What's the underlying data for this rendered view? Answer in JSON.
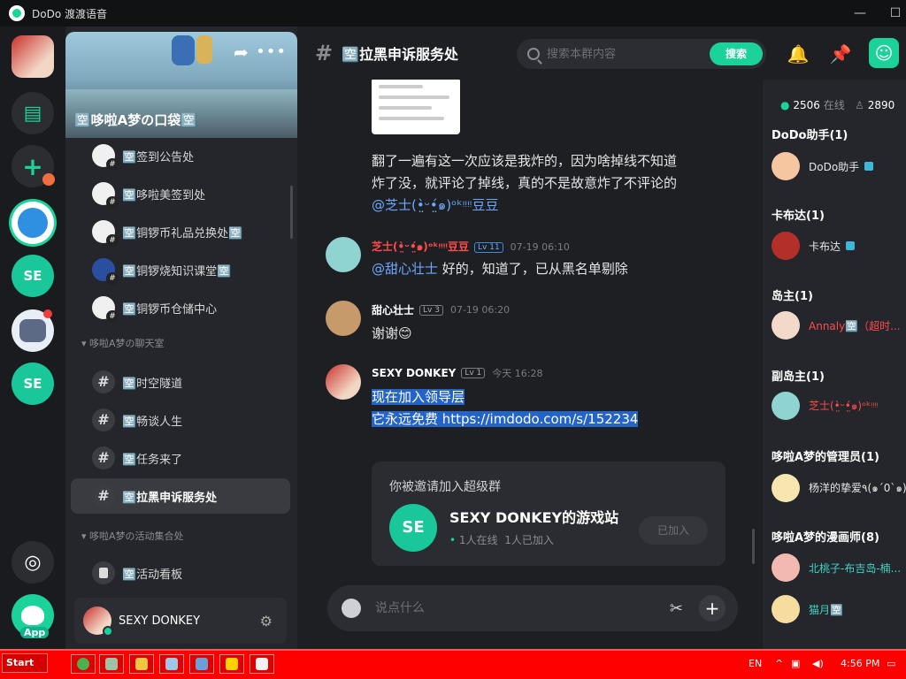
{
  "window": {
    "title": "DoDo 渡渡语音",
    "minimize": "—",
    "maximize": "☐"
  },
  "rail": {
    "servers": [
      "SE",
      "SE"
    ],
    "app_badge": "App"
  },
  "group": {
    "name": "🈳哆啦A梦の口袋🈳",
    "channels": [
      {
        "label": "🈳签到公告处"
      },
      {
        "label": "🈳哆啦美签到处"
      },
      {
        "label": "🈳铜锣币礼品兑换处🈳"
      },
      {
        "label": "🈳铜锣烧知识课堂🈳"
      },
      {
        "label": "🈳铜锣币仓储中心"
      }
    ],
    "category_chat": "哆啦A梦の聊天室",
    "chat_channels": [
      {
        "label": "🈳时空隧道"
      },
      {
        "label": "🈳畅谈人生"
      },
      {
        "label": "🈳任务来了"
      },
      {
        "label": "🈳拉黑申诉服务处"
      }
    ],
    "category_activity": "哆啦A梦の活动集合处",
    "activity_channels": [
      {
        "label": "🈳活动看板"
      }
    ]
  },
  "user": {
    "name": "SEXY DONKEY"
  },
  "header": {
    "hash": "#",
    "title": "🈳拉黑申诉服务处",
    "search_placeholder": "搜索本群内容",
    "search_button": "搜索"
  },
  "messages": {
    "m0_line1": "翻了一遍有这一次应该是我炸的，因为啥掉线不知道",
    "m0_line2": "炸了没，就评论了掉线，真的不是故意炸了不评论的",
    "m0_mention": "@芝士(•̤̀ᵕ•̤́๑)ᵒᵏᵎᵎᵎᵎ豆豆",
    "m1_name": "芝士(•̤̀ᵕ•̤́๑)ᵒᵏᵎᵎᵎᵎ豆豆",
    "m1_level": "Lv 11",
    "m1_time": "07-19 06:10",
    "m1_mention": "@甜心壮士",
    "m1_text": " 好的，知道了，已从黑名单剔除",
    "m2_name": "甜心壮士",
    "m2_level": "Lv 3",
    "m2_time": "07-19 06:20",
    "m2_text": "谢谢😊",
    "m3_name": "SEXY DONKEY",
    "m3_level": "Lv 1",
    "m3_time": "今天 16:28",
    "m3_line1": "现在加入领导层",
    "m3_line2": "它永远免费 https://imdodo.com/s/152234"
  },
  "invite": {
    "title": "你被邀请加入超级群",
    "icon_text": "SE",
    "name": "SEXY DONKEY的游戏站",
    "online": "1人在线",
    "joined": "1人已加入",
    "button": "已加入"
  },
  "composer": {
    "placeholder": "说点什么",
    "plus": "+"
  },
  "members": {
    "online_count": "2506",
    "online_label": "在线",
    "total_count": "2890",
    "groups": [
      {
        "title": "DoDo助手(1)",
        "members": [
          "DoDo助手"
        ]
      },
      {
        "title": "卡布达(1)",
        "members": [
          "卡布达"
        ]
      },
      {
        "title": "岛主(1)",
        "members": [
          "Annaly🈳（超时..."
        ]
      },
      {
        "title": "副岛主(1)",
        "members": [
          "芝士(•̤̀ᵕ•̤́๑)ᵒᵏᵎᵎᵎᵎ"
        ]
      },
      {
        "title": "哆啦A梦的管理员(1)",
        "members": [
          "杨洋的挚爱٩(๑´0`๑)۶"
        ]
      },
      {
        "title": "哆啦A梦的漫画师(8)",
        "members": [
          "北桃子-布吉岛-楠...",
          "猫月🈳"
        ]
      }
    ]
  },
  "taskbar": {
    "start": "Start",
    "lang": "EN",
    "clock": "4:56 PM"
  },
  "colors": {
    "accent": "#1bd39a",
    "mention": "#6ea8ff",
    "taskbar": "#ff0000",
    "highlight": "#2463c7"
  }
}
